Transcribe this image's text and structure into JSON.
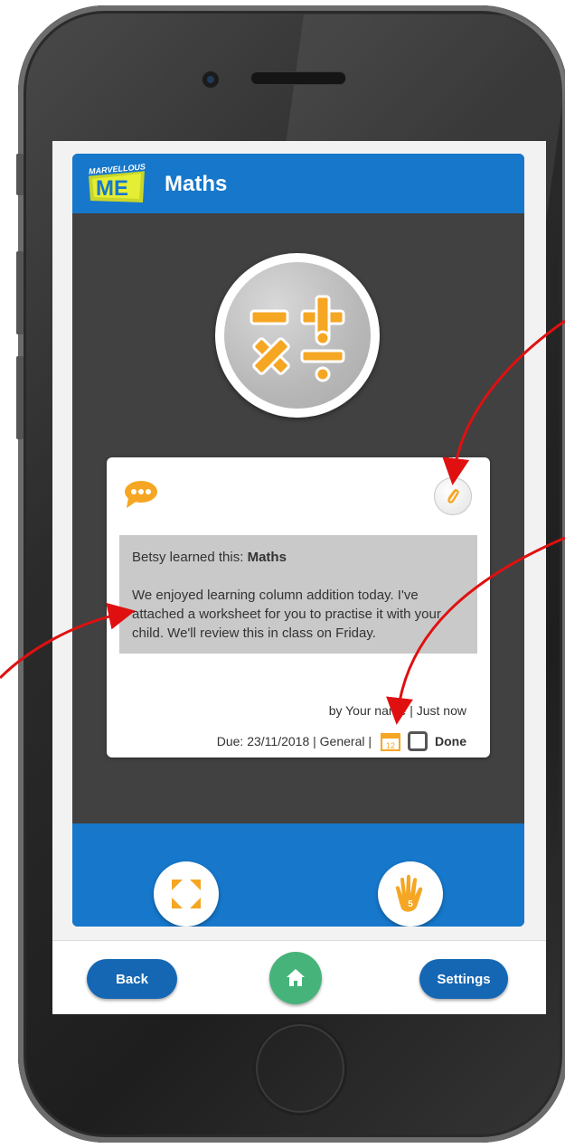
{
  "app": {
    "logo_text": "MARVELLOUS",
    "title": "Maths"
  },
  "card": {
    "learned_prefix": "Betsy learned this: ",
    "learned_subject": "Maths",
    "message": "We enjoyed learning column addition today. I've attached a worksheet for you to practise it with your child. We'll review this in class on Friday.",
    "byline": "by Your name | Just now",
    "due": "Due: 23/11/2018 | General |",
    "calendar_day": "12",
    "done_label": "Done"
  },
  "nav": {
    "back_label": "Back",
    "settings_label": "Settings"
  },
  "icons": {
    "subject": "maths-operators-icon",
    "comment": "speech-bubble-icon",
    "attachment": "paperclip-icon",
    "calendar": "calendar-icon",
    "expand": "expand-arrows-icon",
    "high_five": "high-five-hand-icon",
    "home": "home-icon"
  },
  "colors": {
    "brand_blue": "#1677cb",
    "accent_orange": "#f5a623",
    "home_green": "#46b37a",
    "annotation_red": "#e01010"
  }
}
